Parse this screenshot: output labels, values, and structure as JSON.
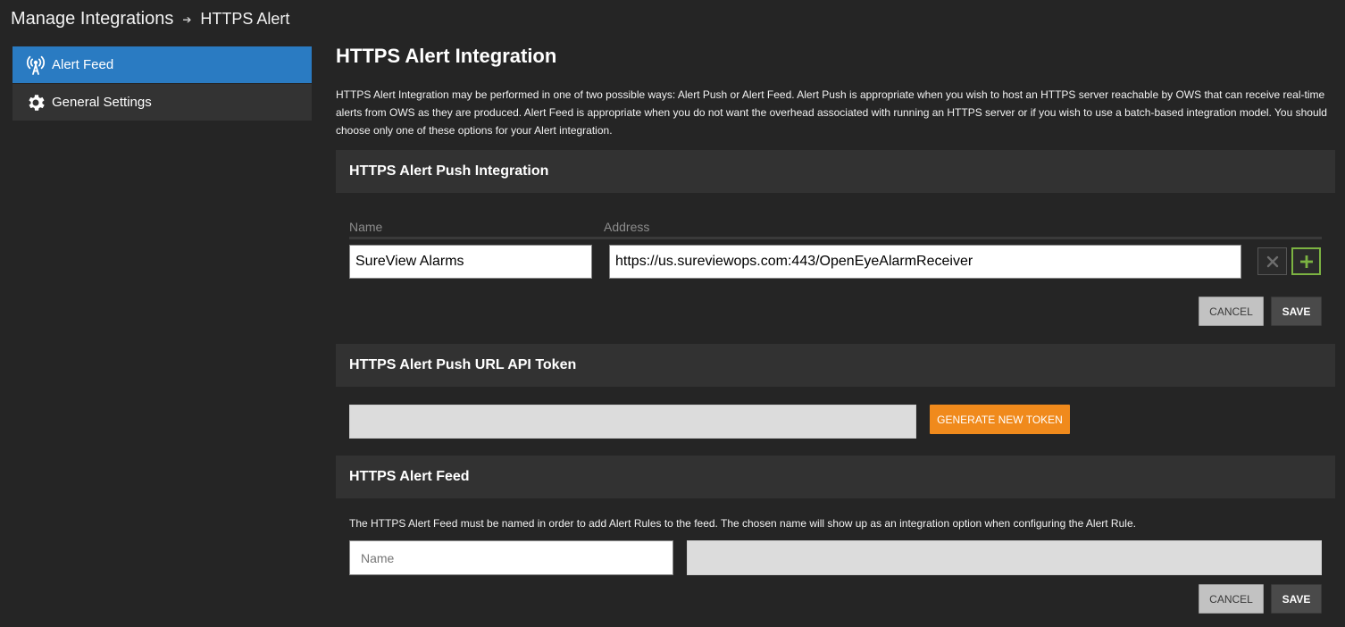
{
  "breadcrumb": {
    "root": "Manage Integrations",
    "separator": "➔",
    "current": "HTTPS Alert"
  },
  "sidebar": {
    "items": [
      {
        "label": "Alert Feed",
        "icon": "broadcast-icon",
        "active": true
      },
      {
        "label": "General Settings",
        "icon": "gear-icon",
        "active": false
      }
    ]
  },
  "main": {
    "title": "HTTPS Alert Integration",
    "intro": "HTTPS Alert Integration may be performed in one of two possible ways: Alert Push or Alert Feed. Alert Push is appropriate when you wish to host an HTTPS server reachable by OWS that can receive real-time alerts from OWS as they are produced. Alert Feed is appropriate when you do not want the overhead associated with running an HTTPS server or if you wish to use a batch-based integration model. You should choose only one of these options for your Alert integration."
  },
  "push": {
    "header": "HTTPS Alert Push Integration",
    "name_label": "Name",
    "address_label": "Address",
    "name_value": "SureView Alarms",
    "address_value": "https://us.sureviewops.com:443/OpenEyeAlarmReceiver",
    "remove_icon": "close-icon",
    "add_icon": "plus-icon",
    "cancel_label": "CANCEL",
    "save_label": "SAVE"
  },
  "token": {
    "header": "HTTPS Alert Push URL API Token",
    "value": "",
    "generate_label": "GENERATE NEW TOKEN"
  },
  "feed": {
    "header": "HTTPS Alert Feed",
    "note": "The HTTPS Alert Feed must be named in order to add Alert Rules to the feed. The chosen name will show up as an integration option when configuring the Alert Rule.",
    "name_placeholder": "Name",
    "url_value": "",
    "cancel_label": "CANCEL",
    "save_label": "SAVE"
  },
  "colors": {
    "background": "#252525",
    "active_sidebar": "#2a7bc2",
    "accent_orange": "#f08a1c",
    "add_green": "#7cb342"
  }
}
